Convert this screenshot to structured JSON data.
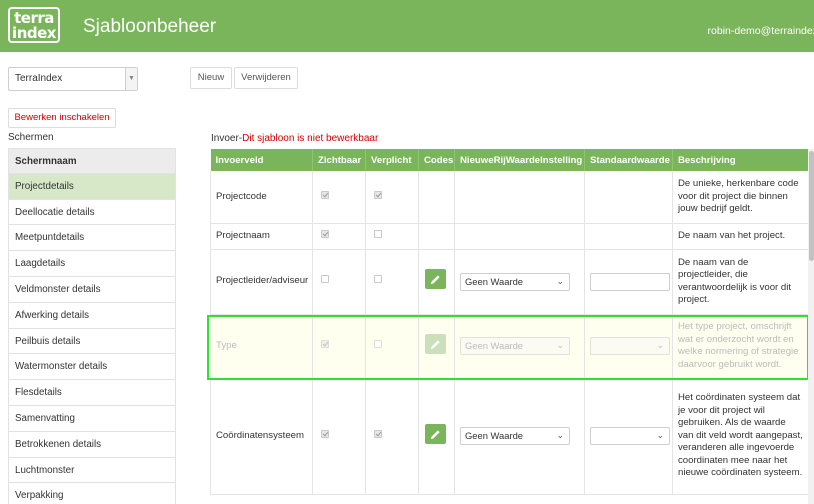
{
  "header": {
    "logo_line1": "terra",
    "logo_line2": "index",
    "title": "Sjabloonbeheer",
    "user": "robin-demo@terraindex"
  },
  "project_select": {
    "value": "TerraIndex"
  },
  "toolbar": {
    "new_label": "Nieuw",
    "delete_label": "Verwijderen"
  },
  "edit_toggle": {
    "label": "Bewerken inschakelen"
  },
  "sidebar": {
    "label": "Schermen",
    "header": "Schermnaam",
    "items": [
      "Projectdetails",
      "Deellocatie details",
      "Meetpuntdetails",
      "Laagdetails",
      "Veldmonster details",
      "Afwerking details",
      "Peilbuis details",
      "Watermonster details",
      "Flesdetails",
      "Samenvatting",
      "Betrokkenen details",
      "Luchtmonster",
      "Verpakking"
    ],
    "active_index": 0
  },
  "main": {
    "title_prefix": "Invoer-",
    "title_warning": "Dit sjabloon is niet bewerkbaar",
    "columns": [
      "Invoerveld",
      "Zichtbaar",
      "Verplicht",
      "Codes",
      "NieuweRijWaardeInstelling",
      "Standaardwaarde",
      "Beschrijving"
    ],
    "rows": [
      {
        "field": "Projectcode",
        "visible": true,
        "required": true,
        "codes": false,
        "new_row_value": "",
        "default_value": "",
        "description": "De unieke, herkenbare code voor dit project die binnen jouw bedrijf geldt."
      },
      {
        "field": "Projectnaam",
        "visible": true,
        "required": false,
        "codes": false,
        "new_row_value": "",
        "default_value": "",
        "description": "De naam van het project."
      },
      {
        "field": "Projectleider/adviseur",
        "visible": false,
        "required": false,
        "codes": true,
        "new_row_value": "Geen Waarde",
        "default_value": "",
        "description": "De naam van de projectleider, die verantwoordelijk is voor dit project."
      },
      {
        "field": "Type",
        "visible": true,
        "required": false,
        "codes": true,
        "new_row_value": "Geen Waarde",
        "default_value": "",
        "description": "Het type project, omschrijft wat er onderzocht wordt en welke normering of strategie daarvoor gebruikt wordt."
      },
      {
        "field": "Coördinatensysteem",
        "visible": true,
        "required": true,
        "codes": true,
        "new_row_value": "Geen Waarde",
        "default_value": "",
        "description": "Het coördinaten systeem dat je voor dit project wil gebruiken. Als de waarde van dit veld wordt aangepast, veranderen alle ingevoerde coordinaten mee naar het nieuwe coördinaten systeem."
      }
    ]
  },
  "colors": {
    "brand_green": "#7ab55c",
    "warning_red": "#d40000",
    "highlight": "#33dd33"
  }
}
